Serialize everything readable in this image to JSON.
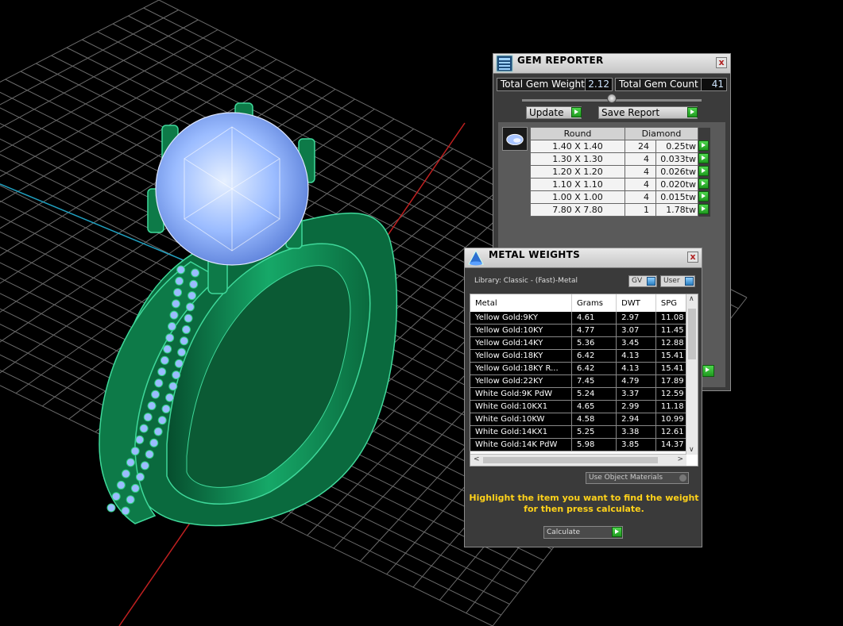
{
  "gem_reporter": {
    "title": "GEM REPORTER",
    "close": "x",
    "total_weight_label": "Total Gem Weight",
    "total_weight_value": "2.12",
    "total_count_label": "Total Gem Count",
    "total_count_value": "41",
    "update_label": "Update",
    "save_label": "Save Report",
    "columns": [
      "Round",
      "Diamond"
    ],
    "rows": [
      {
        "size": "1.40 X 1.40",
        "count": "24",
        "tw": "0.25tw"
      },
      {
        "size": "1.30 X 1.30",
        "count": "4",
        "tw": "0.033tw"
      },
      {
        "size": "1.20 X 1.20",
        "count": "4",
        "tw": "0.026tw"
      },
      {
        "size": "1.10 X 1.10",
        "count": "4",
        "tw": "0.020tw"
      },
      {
        "size": "1.00 X 1.00",
        "count": "4",
        "tw": "0.015tw"
      },
      {
        "size": "7.80 X 7.80",
        "count": "1",
        "tw": "1.78tw"
      }
    ]
  },
  "metal_weights": {
    "title": "METAL WEIGHTS",
    "close": "x",
    "library": "Library: Classic - (Fast)-Metal",
    "toggle_gv": "GV",
    "toggle_user": "User",
    "columns": [
      "Metal",
      "Grams",
      "DWT",
      "SPG"
    ],
    "rows": [
      {
        "metal": "Yellow Gold:9KY",
        "grams": "4.61",
        "dwt": "2.97",
        "spg": "11.08"
      },
      {
        "metal": "Yellow Gold:10KY",
        "grams": "4.77",
        "dwt": "3.07",
        "spg": "11.45"
      },
      {
        "metal": "Yellow Gold:14KY",
        "grams": "5.36",
        "dwt": "3.45",
        "spg": "12.88"
      },
      {
        "metal": "Yellow Gold:18KY",
        "grams": "6.42",
        "dwt": "4.13",
        "spg": "15.41"
      },
      {
        "metal": "Yellow Gold:18KY R...",
        "grams": "6.42",
        "dwt": "4.13",
        "spg": "15.41"
      },
      {
        "metal": "Yellow Gold:22KY",
        "grams": "7.45",
        "dwt": "4.79",
        "spg": "17.89"
      },
      {
        "metal": "White Gold:9K PdW",
        "grams": "5.24",
        "dwt": "3.37",
        "spg": "12.59"
      },
      {
        "metal": "White Gold:10KX1",
        "grams": "4.65",
        "dwt": "2.99",
        "spg": "11.18"
      },
      {
        "metal": "White Gold:10KW",
        "grams": "4.58",
        "dwt": "2.94",
        "spg": "10.99"
      },
      {
        "metal": "White Gold:14KX1",
        "grams": "5.25",
        "dwt": "3.38",
        "spg": "12.61"
      },
      {
        "metal": "White Gold:14K PdW",
        "grams": "5.98",
        "dwt": "3.85",
        "spg": "14.37"
      }
    ],
    "use_object_materials": "Use Object Materials",
    "hint_line1": "Highlight the item you want to find the weight",
    "hint_line2": "for then press calculate.",
    "calculate": "Calculate"
  },
  "colors": {
    "metal": "#0f7a4a",
    "metal_highlight": "#3fd89a",
    "gem": "#8fb4ff",
    "grid": "#6a6a6a",
    "axis_x": "#c02020",
    "axis_y": "#20a0c0",
    "hint": "#ffd21a"
  }
}
